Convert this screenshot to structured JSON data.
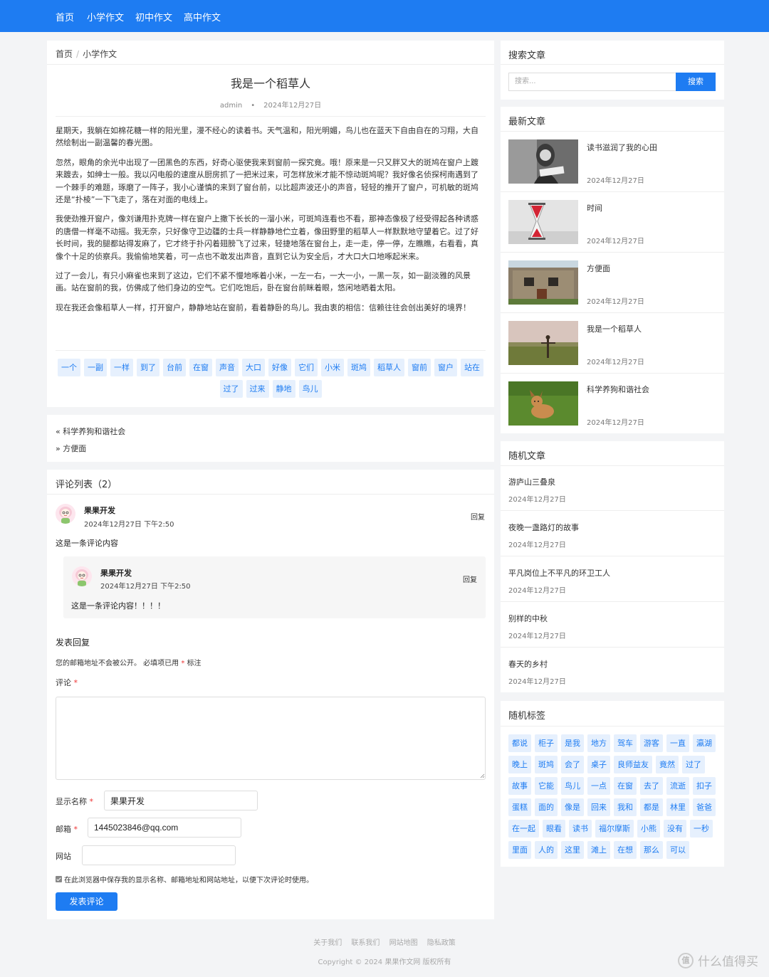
{
  "nav": [
    "首页",
    "小学作文",
    "初中作文",
    "高中作文"
  ],
  "breadcrumb": {
    "home": "首页",
    "sep": "/",
    "current": "小学作文"
  },
  "article": {
    "title": "我是一个稻草人",
    "author": "admin",
    "dot": "•",
    "date": "2024年12月27日",
    "paragraphs": [
      "星期天，我躺在如棉花糖一样的阳光里，漫不经心的读着书。天气温和，阳光明媚，鸟儿也在蓝天下自由自在的习翔，大自然绘制出一副温馨的春光图。",
      "忽然，眼角的余光中出现了一团黑色的东西，好奇心驱使我来到窗前一探究竟。哦！原来是一只又胖又大的斑鸠在窗户上踱来踱去，如绅士一般。我以闪电般的速度从厨房抓了一把米过来，可怎样放米才能不惊动斑鸠呢？我好像名侦探柯南遇到了一个棘手的难题，琢磨了一阵子，我小心谨慎的来到了窗台前，以比超声波还小的声音，轻轻的推开了窗户，可机敏的斑鸠还是“扑棱”一下飞走了，落在对面的电线上。",
      "我使劲推开窗户，像刘谦甩扑克牌一样在窗户上撒下长长的一溜小米，可斑鸠连看也不看，那神态像极了经受得起各种诱惑的唐僧一样毫不动摇。我无奈，只好像守卫边疆的士兵一样静静地伫立着，像田野里的稻草人一样默默地守望着它。过了好长时间，我的腿都站得发麻了，它才终于扑闪着翅膀飞了过来，轻捷地落在窗台上，走一走，停一停，左瞧瞧，右看看，真像个十足的侦察兵。我偷偷地笑着，可一点也不敢发出声音，直到它认为安全后，才大口大口地啄起米来。",
      "过了一会儿，有只小麻雀也来到了这边，它们不紧不慢地啄着小米，一左一右，一大一小，一黑一灰，如一副淡雅的风景画。站在窗前的我，仿佛成了他们身边的空气。它们吃饱后，卧在窗台前眯着眼，悠闲地晒着太阳。",
      "现在我还会像稻草人一样，打开窗户，静静地站在窗前，看着静卧的鸟儿。我由衷的相信：信赖往往会创出美好的境界！"
    ],
    "tags": [
      "一个",
      "一副",
      "一样",
      "到了",
      "台前",
      "在窗",
      "声音",
      "大口",
      "好像",
      "它们",
      "小米",
      "斑鸠",
      "稻草人",
      "窗前",
      "窗户",
      "站在",
      "过了",
      "过来",
      "静地",
      "鸟儿"
    ]
  },
  "prevnext": {
    "prev": "« 科学养狗和谐社会",
    "next": "» 方便面"
  },
  "comments": {
    "title": "评论列表（2）",
    "items": [
      {
        "author": "果果开发",
        "date": "2024年12月27日 下午2:50",
        "reply": "回复",
        "text": "这是一条评论内容"
      },
      {
        "author": "果果开发",
        "date": "2024年12月27日 下午2:50",
        "reply": "回复",
        "text": "这是一条评论内容！！！！"
      }
    ]
  },
  "form": {
    "title": "发表回复",
    "notice": "您的邮箱地址不会被公开。 必填项已用",
    "notice_mark": "*",
    "notice_tail": "标注",
    "comment_label": "评论",
    "name_label": "显示名称",
    "name_value": "果果开发",
    "email_label": "邮箱",
    "email_value": "1445023846@qq.com",
    "website_label": "网站",
    "website_value": "",
    "required_mark": "*",
    "cookie_text": "在此浏览器中保存我的显示名称、邮箱地址和网站地址，以便下次评论时使用。",
    "submit": "发表评论"
  },
  "sidebar": {
    "search": {
      "title": "搜索文章",
      "placeholder": "搜索...",
      "button": "搜索"
    },
    "latest": {
      "title": "最新文章",
      "items": [
        {
          "title": "读书滋润了我的心田",
          "date": "2024年12月27日"
        },
        {
          "title": "时间",
          "date": "2024年12月27日"
        },
        {
          "title": "方便面",
          "date": "2024年12月27日"
        },
        {
          "title": "我是一个稻草人",
          "date": "2024年12月27日"
        },
        {
          "title": "科学养狗和谐社会",
          "date": "2024年12月27日"
        }
      ]
    },
    "random": {
      "title": "随机文章",
      "items": [
        {
          "title": "游庐山三叠泉",
          "date": "2024年12月27日"
        },
        {
          "title": "夜晚一盏路灯的故事",
          "date": "2024年12月27日"
        },
        {
          "title": "平凡岗位上不平凡的环卫工人",
          "date": "2024年12月27日"
        },
        {
          "title": "别样的中秋",
          "date": "2024年12月27日"
        },
        {
          "title": "春天的乡村",
          "date": "2024年12月27日"
        }
      ]
    },
    "tags": {
      "title": "随机标签",
      "items": [
        "都说",
        "柜子",
        "是我",
        "地方",
        "驾车",
        "游客",
        "一直",
        "瀛湖",
        "晚上",
        "斑鸠",
        "会了",
        "桌子",
        "良师益友",
        "竟然",
        "过了",
        "故事",
        "它能",
        "鸟儿",
        "一点",
        "在窗",
        "去了",
        "流逝",
        "扣子",
        "蛋糕",
        "面的",
        "像是",
        "回来",
        "我和",
        "都是",
        "林里",
        "爸爸",
        "在一起",
        "眼看",
        "读书",
        "福尔摩斯",
        "小熊",
        "没有",
        "一秒",
        "里面",
        "人的",
        "这里",
        "滩上",
        "在想",
        "那么",
        "可以"
      ]
    }
  },
  "footer": {
    "links": [
      "关于我们",
      "联系我们",
      "网站地图",
      "隐私政策"
    ],
    "copyright": "Copyright © 2024 果果作文网 版权所有"
  },
  "watermark": {
    "logo": "值",
    "text": "什么值得买"
  },
  "colors": {
    "primary": "#1e7cf2",
    "tag_bg": "#e6f0fd",
    "page_bg": "#f3f4f6"
  }
}
